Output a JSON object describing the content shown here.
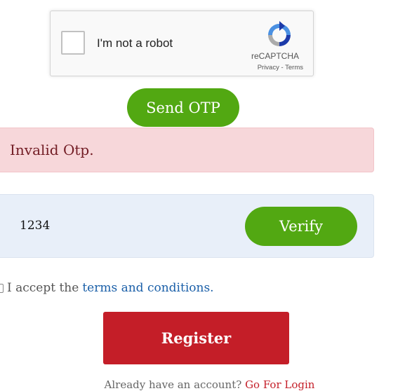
{
  "recaptcha": {
    "label": "I'm not a robot",
    "brand": "reCAPTCHA",
    "privacy": "Privacy",
    "separator": " - ",
    "terms": "Terms"
  },
  "send_otp": {
    "label": "Send OTP"
  },
  "alert": {
    "message": "Invalid Otp."
  },
  "otp": {
    "value": "1234"
  },
  "verify": {
    "label": "Verify"
  },
  "terms_row": {
    "prefix": "I accept the",
    "link": "terms and conditions."
  },
  "register": {
    "label": "Register"
  },
  "login": {
    "prompt": "Already have an account?",
    "link": "Go For Login"
  },
  "colors": {
    "green": "#52a812",
    "red": "#c41e28",
    "alert_bg": "#f7d7da",
    "alert_text": "#721c24",
    "panel_bg": "#e8eff9",
    "link_blue": "#1a5fa8"
  },
  "icons": {
    "recaptcha_logo": "recaptcha-logo-icon"
  }
}
